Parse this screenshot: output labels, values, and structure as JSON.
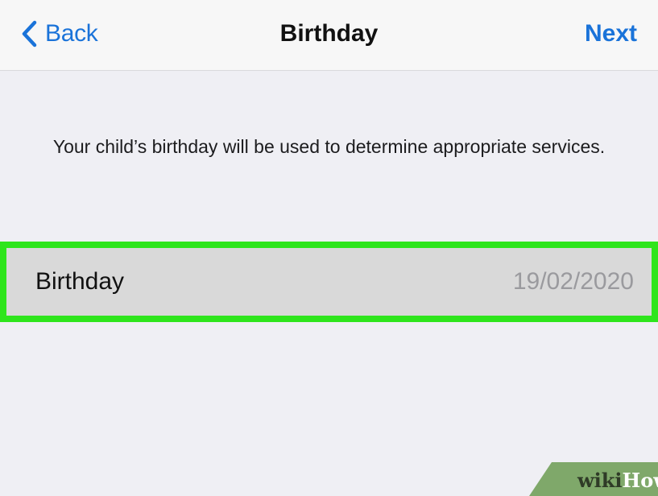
{
  "navbar": {
    "back_label": "Back",
    "back_icon": "chevron-left-icon",
    "title": "Birthday",
    "next_label": "Next",
    "accent_color": "#1a73d9"
  },
  "description": "Your child’s birthday will be used to determine appropriate services.",
  "birthday_row": {
    "label": "Birthday",
    "value": "19/02/2020",
    "highlight_color": "#2ee51c"
  },
  "watermark": {
    "part1": "wiki",
    "part2": "How"
  }
}
